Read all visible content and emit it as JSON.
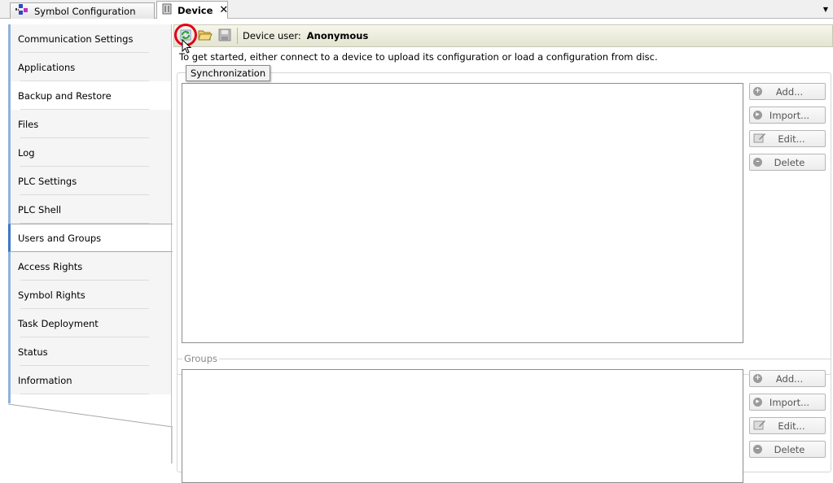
{
  "tabs": [
    {
      "label": "Symbol Configuration",
      "icon": "symbol-config-icon"
    },
    {
      "label": "Device",
      "icon": "device-icon",
      "active": true
    }
  ],
  "nav": {
    "items": [
      {
        "label": "Communication Settings"
      },
      {
        "label": "Applications"
      },
      {
        "label": "Backup and Restore"
      },
      {
        "label": "Files"
      },
      {
        "label": "Log"
      },
      {
        "label": "PLC Settings"
      },
      {
        "label": "PLC Shell"
      },
      {
        "label": "Users and Groups"
      },
      {
        "label": "Access Rights"
      },
      {
        "label": "Symbol Rights"
      },
      {
        "label": "Task Deployment"
      },
      {
        "label": "Status"
      },
      {
        "label": "Information"
      }
    ],
    "active_index": 7
  },
  "toolbar": {
    "device_user_label": "Device user:",
    "device_user_value": "Anonymous",
    "sync_icon": "sync-icon",
    "open_icon": "open-folder-icon",
    "save_icon": "save-icon"
  },
  "hint": "To get started, either connect to a device to upload its configuration or load a configuration from disc.",
  "tooltip": "Synchronization",
  "users_group": {
    "buttons": {
      "add": "Add...",
      "import": "Import...",
      "edit": "Edit...",
      "delete": "Delete"
    }
  },
  "groups_group": {
    "title": "Groups",
    "buttons": {
      "add": "Add...",
      "import": "Import...",
      "edit": "Edit...",
      "delete": "Delete"
    }
  },
  "colors": {
    "accent": "#3c78c8",
    "highlight_circle": "#e0001b",
    "sync_green": "#2e9a2e"
  }
}
